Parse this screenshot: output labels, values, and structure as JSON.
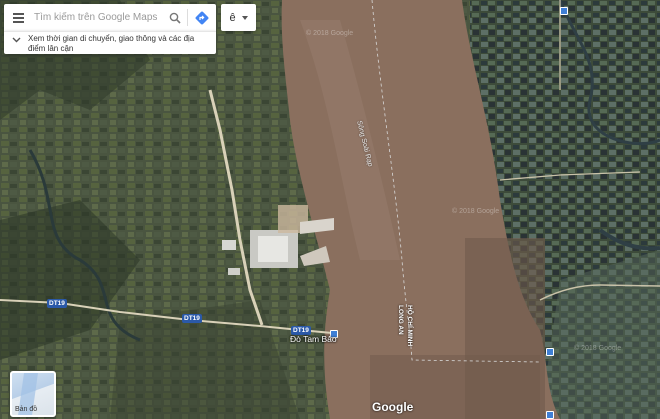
{
  "search": {
    "placeholder": "Tìm kiếm trên Google Maps"
  },
  "panel": {
    "text": "Xem thời gian di chuyển, giao thông và các địa điểm lân cận"
  },
  "language_button": {
    "label": "ê"
  },
  "basemap_toggle": {
    "label": "Bản đồ"
  },
  "roads": [
    {
      "label": "DT19"
    },
    {
      "label": "DT19"
    },
    {
      "label": "DT19"
    }
  ],
  "places": {
    "ferry": "Đò Tam Bảo",
    "river": "Sông Soài Rạp",
    "boundary_top": "HỒ CHÍ MINH",
    "boundary_bottom": "LONG AN"
  },
  "watermarks": [
    "© 2018 Google",
    "© 2018 Google",
    "© 2018 Google"
  ],
  "google_logo": "Google",
  "colors": {
    "river": "#8a6f5e",
    "land_dark": "#3e4a35",
    "road": "#d9d1b8",
    "shield": "#2b59a8",
    "directions": "#4285f4"
  }
}
